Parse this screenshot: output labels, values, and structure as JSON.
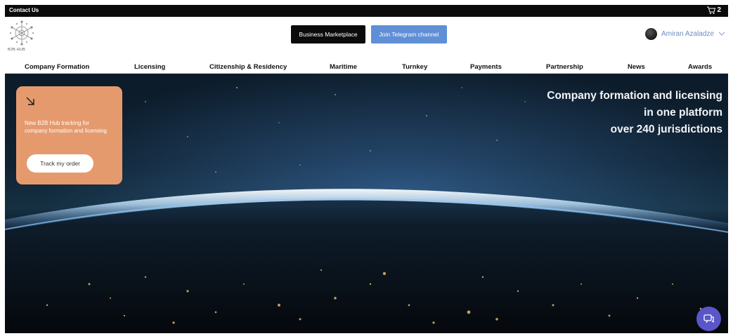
{
  "topbar": {
    "contact_label": "Contact Us",
    "cart_count": "2"
  },
  "header": {
    "logo_text": "B2B HUB",
    "market_button": "Business Marketplace",
    "telegram_button": "Join Telegram channel",
    "user_name": "Amiran Azaladze"
  },
  "nav": {
    "items": [
      "Company Formation",
      "Licensing",
      "Citizenship & Residency",
      "Maritime",
      "Turnkey",
      "Payments",
      "Partnership",
      "News",
      "Awards"
    ]
  },
  "hero": {
    "tagline": [
      "Company formation and licensing",
      "in one platform",
      "over 240 jurisdictions"
    ]
  },
  "promo": {
    "text": "New B2B Hub tracking for company formation and licensing",
    "button": "Track my order"
  },
  "colors": {
    "promo_bg": "#e59a6e",
    "telegram_blue": "#5f8fd6",
    "chat_purple": "#5a55c8",
    "user_name_blue": "#6d8dbf"
  },
  "icons": {
    "cart": "cart-icon",
    "chevron": "chevron-down-icon",
    "arrow": "arrow-down-right-icon",
    "chat": "chat-icon",
    "logo": "snowflake-logo"
  }
}
